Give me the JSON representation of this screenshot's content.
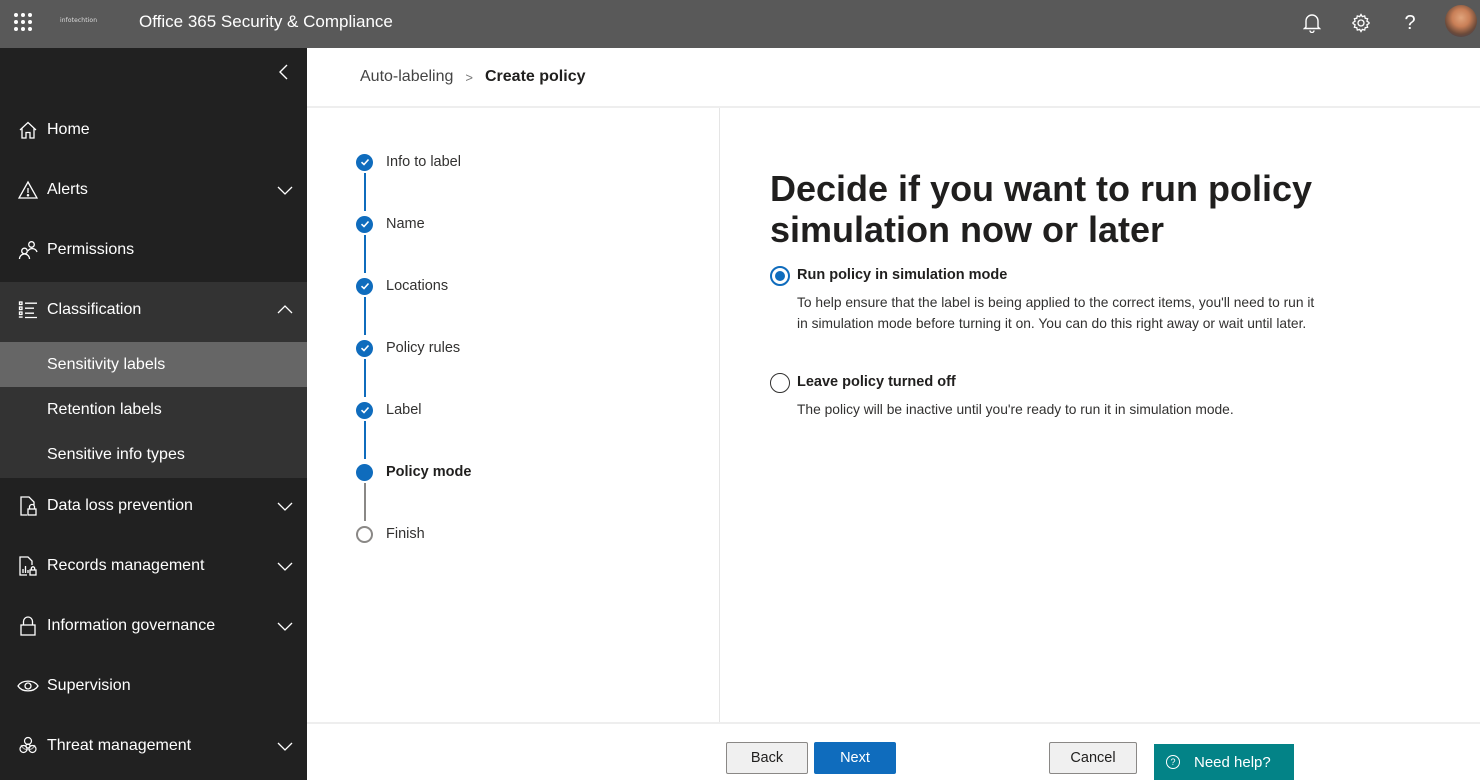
{
  "topbar": {
    "app_launcher_icon": "waffle-icon",
    "brand": "infotechtion",
    "title": "Office 365 Security & Compliance",
    "icons": [
      "bell-icon",
      "gear-icon",
      "help-icon"
    ],
    "avatar": "user-avatar"
  },
  "sidebar": {
    "collapse_icon": "chevron-left-icon",
    "items": [
      {
        "label": "Home",
        "icon": "home-icon",
        "expandable": false
      },
      {
        "label": "Alerts",
        "icon": "warning-icon",
        "expandable": true
      },
      {
        "label": "Permissions",
        "icon": "people-icon",
        "expandable": false
      },
      {
        "label": "Classification",
        "icon": "list-icon",
        "expandable": true,
        "expanded": true
      },
      {
        "label": "Data loss prevention",
        "icon": "document-lock-icon",
        "expandable": true
      },
      {
        "label": "Records management",
        "icon": "report-lock-icon",
        "expandable": true
      },
      {
        "label": "Information governance",
        "icon": "lock-icon",
        "expandable": true
      },
      {
        "label": "Supervision",
        "icon": "eye-icon",
        "expandable": false
      },
      {
        "label": "Threat management",
        "icon": "biohazard-icon",
        "expandable": true
      }
    ],
    "classification_children": [
      {
        "label": "Sensitivity labels",
        "active": true
      },
      {
        "label": "Retention labels",
        "active": false
      },
      {
        "label": "Sensitive info types",
        "active": false
      }
    ]
  },
  "breadcrumb": {
    "parent": "Auto-labeling",
    "separator": ">",
    "current": "Create policy"
  },
  "wizard": {
    "steps": [
      {
        "label": "Info to label",
        "status": "complete"
      },
      {
        "label": "Name",
        "status": "complete"
      },
      {
        "label": "Locations",
        "status": "complete"
      },
      {
        "label": "Policy rules",
        "status": "complete"
      },
      {
        "label": "Label",
        "status": "complete"
      },
      {
        "label": "Policy mode",
        "status": "current"
      },
      {
        "label": "Finish",
        "status": "pending"
      }
    ]
  },
  "content": {
    "heading": "Decide if you want to run policy simulation now or later",
    "options": [
      {
        "label": "Run policy in simulation mode",
        "description": "To help ensure that the label is being applied to the correct items, you'll need to run it in simulation mode before turning it on. You can do this right away or wait until later.",
        "selected": true
      },
      {
        "label": "Leave policy turned off",
        "description": "The policy will be inactive until you're ready to run it in simulation mode.",
        "selected": false
      }
    ]
  },
  "footer": {
    "back_label": "Back",
    "next_label": "Next",
    "cancel_label": "Cancel",
    "help_label": "Need help?"
  },
  "colors": {
    "accent": "#0f6cbd",
    "topbar": "#595959",
    "sidebar": "#212121",
    "help_button": "#038387"
  }
}
